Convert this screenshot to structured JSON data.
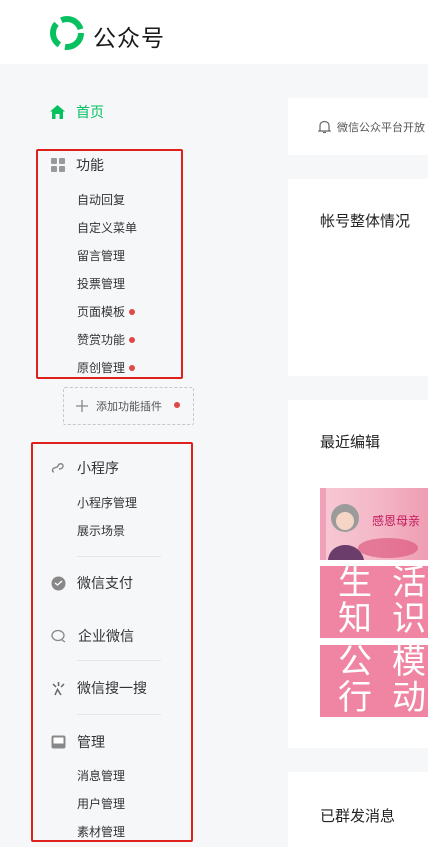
{
  "header": {
    "brand": "公众号"
  },
  "sidebar": {
    "home": "首页",
    "features": {
      "title": "功能",
      "items": [
        {
          "label": "自动回复",
          "dot": false
        },
        {
          "label": "自定义菜单",
          "dot": false
        },
        {
          "label": "留言管理",
          "dot": false
        },
        {
          "label": "投票管理",
          "dot": false
        },
        {
          "label": "页面模板",
          "dot": true
        },
        {
          "label": "赞赏功能",
          "dot": true
        },
        {
          "label": "原创管理",
          "dot": true
        }
      ]
    },
    "add_plugin": "添加功能插件",
    "miniprogram": {
      "title": "小程序",
      "items": [
        "小程序管理",
        "展示场景"
      ]
    },
    "wechat_pay": "微信支付",
    "wecom": "企业微信",
    "search": "微信搜一搜",
    "manage": {
      "title": "管理",
      "items": [
        "消息管理",
        "用户管理",
        "素材管理"
      ]
    }
  },
  "main": {
    "notice_text": "微信公众平台开放",
    "account_overview_title": "帐号整体情况",
    "recent_edit_title": "最近编辑",
    "sent_title": "已群发消息",
    "banner_text": "感恩母亲",
    "poster_chars": [
      "生",
      "活",
      "知",
      "识",
      "公",
      "模",
      "行",
      "动"
    ]
  },
  "colors": {
    "accent": "#07c160",
    "highlight": "#e0201c",
    "dot": "#e04848"
  }
}
